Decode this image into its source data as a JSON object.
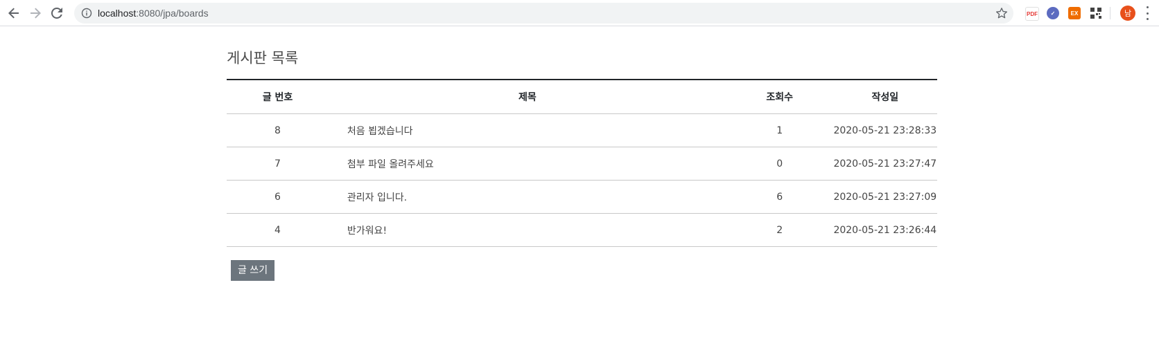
{
  "browser": {
    "url_host": "localhost",
    "url_path": ":8080/jpa/boards",
    "profile_initial": "남",
    "extensions": [
      {
        "name": "pdf-extension-icon",
        "label": "PDF",
        "color": "#e53935"
      },
      {
        "name": "check-extension-icon",
        "label": "✓",
        "color": "#5c6bc0"
      },
      {
        "name": "ex-extension-icon",
        "label": "EX",
        "color": "#ef6c00"
      },
      {
        "name": "qr-extension-icon",
        "label": "",
        "color": "#424242"
      }
    ]
  },
  "page": {
    "title": "게시판 목록",
    "write_button": "글 쓰기"
  },
  "table": {
    "headers": {
      "no": "글 번호",
      "title": "제목",
      "views": "조회수",
      "date": "작성일"
    },
    "rows": [
      {
        "no": "8",
        "title": "처음 뵙겠습니다",
        "views": "1",
        "date": "2020-05-21 23:28:33"
      },
      {
        "no": "7",
        "title": "첨부 파일 올려주세요",
        "views": "0",
        "date": "2020-05-21 23:27:47"
      },
      {
        "no": "6",
        "title": "관리자 입니다.",
        "views": "6",
        "date": "2020-05-21 23:27:09"
      },
      {
        "no": "4",
        "title": "반가워요!",
        "views": "2",
        "date": "2020-05-21 23:26:44"
      }
    ]
  }
}
